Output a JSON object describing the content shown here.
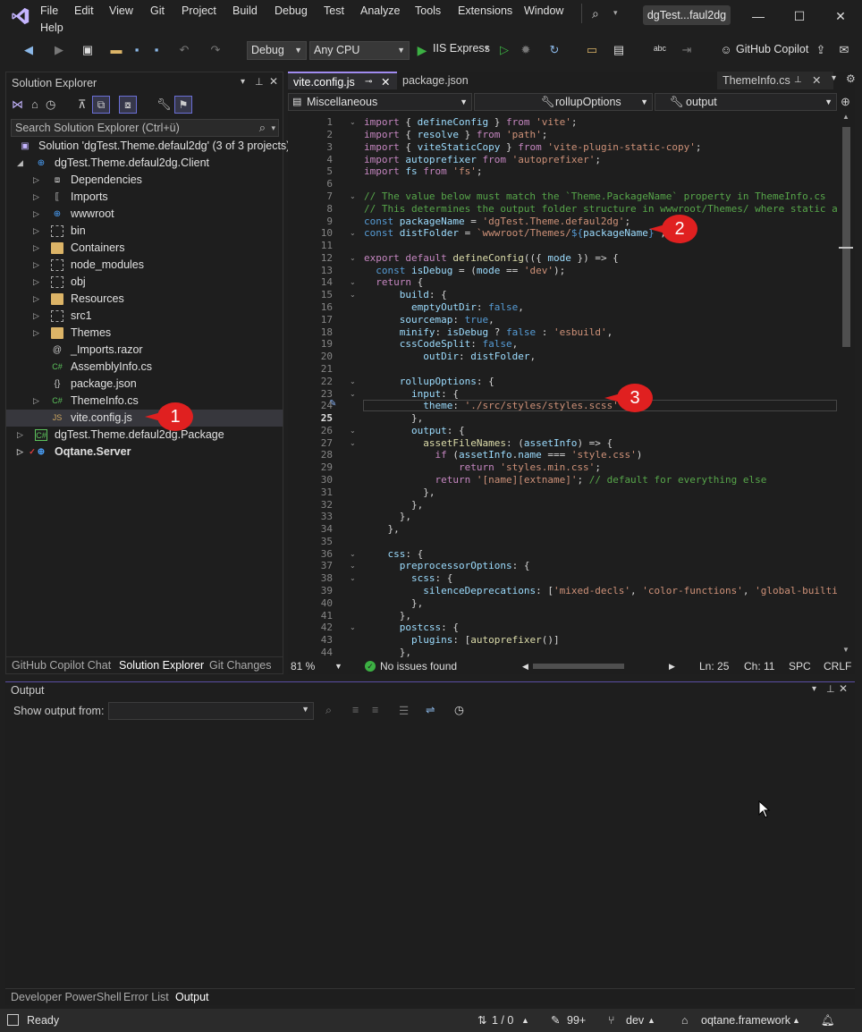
{
  "menu": {
    "items": [
      "File",
      "Edit",
      "View",
      "Git",
      "Project",
      "Build",
      "Debug",
      "Test",
      "Analyze",
      "Tools",
      "Extensions",
      "Window",
      "Help"
    ],
    "window_title": "dgTest...faul2dg"
  },
  "toolbar": {
    "config": "Debug",
    "platform": "Any CPU",
    "run_target": "IIS Express",
    "copilot": "GitHub Copilot"
  },
  "solution_explorer": {
    "title": "Solution Explorer",
    "search_placeholder": "Search Solution Explorer (Ctrl+ü)",
    "items": [
      {
        "label": "Solution 'dgTest.Theme.defaul2dg' (3 of 3 projects)"
      },
      {
        "label": "dgTest.Theme.defaul2dg.Client"
      },
      {
        "label": "Dependencies"
      },
      {
        "label": "Imports"
      },
      {
        "label": "wwwroot"
      },
      {
        "label": "bin"
      },
      {
        "label": "Containers"
      },
      {
        "label": "node_modules"
      },
      {
        "label": "obj"
      },
      {
        "label": "Resources"
      },
      {
        "label": "src1"
      },
      {
        "label": "Themes"
      },
      {
        "label": "_Imports.razor"
      },
      {
        "label": "AssemblyInfo.cs"
      },
      {
        "label": "package.json"
      },
      {
        "label": "ThemeInfo.cs"
      },
      {
        "label": "vite.config.js"
      },
      {
        "label": "dgTest.Theme.defaul2dg.Package"
      },
      {
        "label": "Oqtane.Server"
      }
    ],
    "tabs": [
      "GitHub Copilot Chat",
      "Solution Explorer",
      "Git Changes"
    ]
  },
  "editor": {
    "tabs": [
      "vite.config.js",
      "package.json",
      "ThemeInfo.cs"
    ],
    "nav": [
      "Miscellaneous",
      "rollupOptions",
      "output"
    ],
    "zoom": "81 %",
    "issues": "No issues found",
    "ln": "Ln: 25",
    "ch": "Ch: 11",
    "spc": "SPC",
    "crlf": "CRLF",
    "line_numbers": [
      "1",
      "2",
      "3",
      "4",
      "5",
      "6",
      "7",
      "8",
      "9",
      "10",
      "11",
      "12",
      "13",
      "14",
      "15",
      "16",
      "17",
      "18",
      "19",
      "20",
      "21",
      "22",
      "23",
      "24",
      "25",
      "26",
      "27",
      "28",
      "29",
      "30",
      "31",
      "32",
      "33",
      "34",
      "35",
      "36",
      "37",
      "38",
      "39",
      "40",
      "41",
      "42",
      "43",
      "44"
    ]
  },
  "callouts": [
    "1",
    "2",
    "3"
  ],
  "output": {
    "title": "Output",
    "show_from_label": "Show output from:",
    "tabs": [
      "Developer PowerShell",
      "Error List",
      "Output"
    ]
  },
  "statusbar": {
    "ready": "Ready",
    "updown": "1 / 0",
    "pencil": "99+",
    "branch": "dev",
    "repo": "oqtane.framework"
  }
}
